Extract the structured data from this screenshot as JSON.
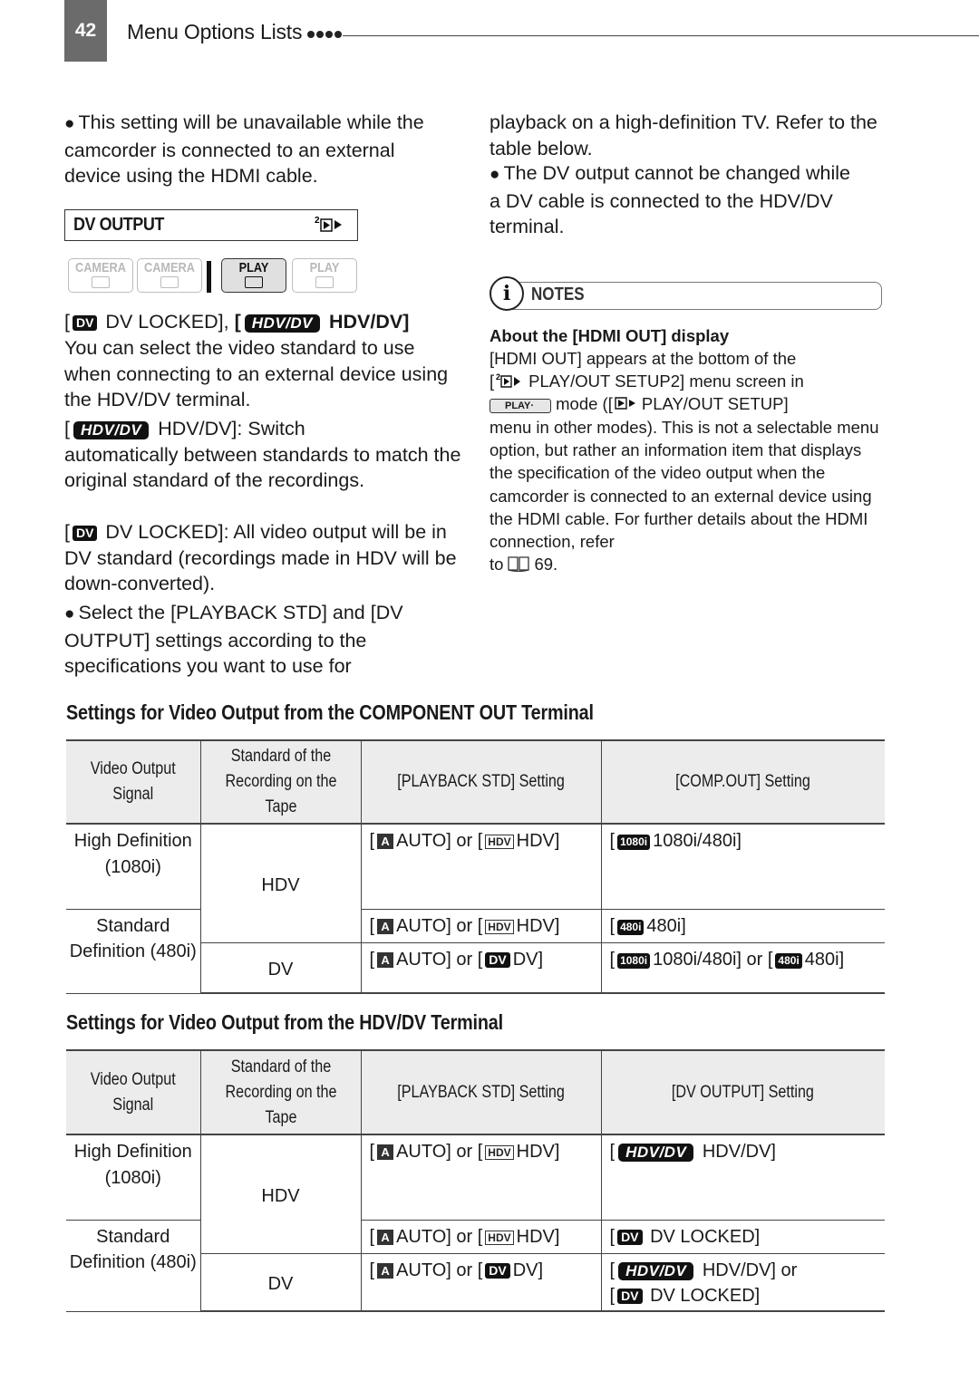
{
  "header": {
    "page_number": "42",
    "running_title": "Menu Options Lists"
  },
  "left_column": {
    "intro_bullet": "This setting will be unavailable while the camcorder is connected to an external device using the HDMI cable.",
    "menu_item": {
      "title": "DV OUTPUT",
      "menu_icon": "play-out-setup-2-icon"
    },
    "modes": [
      {
        "label": "CAMERA",
        "sub_icon": "tape-icon",
        "active": false
      },
      {
        "label": "CAMERA",
        "sub_icon": "card-icon",
        "active": false
      },
      {
        "label": "PLAY",
        "sub_icon": "tape-icon",
        "active": true
      },
      {
        "label": "PLAY",
        "sub_icon": "card-icon",
        "active": false
      }
    ],
    "options_line": {
      "opt1_icon": "DV",
      "opt1_label": "DV LOCKED],",
      "opt2_icon": "HDV/DV",
      "opt2_label": "HDV/DV]"
    },
    "description": "You can select the video standard to use when connecting to an external device using the HDV/DV terminal.",
    "hdvdv_desc": {
      "icon": "HDV/DV",
      "label": "HDV/DV]: Switch",
      "text": "automatically between standards to match the original standard of the recordings."
    },
    "dvlocked_desc": {
      "icon": "DV",
      "label": "DV LOCKED]: All video output will",
      "text": "be in DV standard (recordings made in HDV will be down-converted)."
    },
    "select_bullet": "Select the [PLAYBACK STD] and [DV OUTPUT] settings according to the specifications you want to use for"
  },
  "right_column": {
    "continuation": "playback on a high-definition TV. Refer to the table below.",
    "bullet": "The DV output cannot be changed while a DV cable is connected to the HDV/DV terminal.",
    "notes": {
      "title": "NOTES",
      "subheading": "About the [HDMI OUT] display",
      "line1": "[HDMI OUT] appears at the bottom of the",
      "line2_suffix": "PLAY/OUT SETUP2] menu screen in",
      "play_mode_icon": "PLAY·",
      "line3_mid": "mode ([",
      "line3_suffix": "PLAY/OUT SETUP]",
      "body": "menu in other modes). This is not a selectable menu option, but rather an information item that displays the specification of the video output when the camcorder is connected to an external device using the HDMI cable. For further details about the HDMI connection, refer",
      "ref_prefix": "to",
      "ref_page": "69."
    }
  },
  "tables": [
    {
      "heading": "Settings for Video Output from the COMPONENT OUT Terminal",
      "columns": [
        "Video Output Signal",
        "Standard of the Recording on the Tape",
        "[PLAYBACK STD] Setting",
        "[COMP.OUT] Setting"
      ],
      "signal_groups": [
        "High Definition (1080i)",
        "Standard Definition (480i)"
      ],
      "tape_groups": [
        "HDV",
        "DV"
      ],
      "rows": [
        {
          "playback": {
            "a": "AUTO] or [",
            "b_icon": "HDV",
            "b": "HDV]"
          },
          "setting": "[ 1080i 1080i/480i]"
        },
        {
          "playback": {
            "a": "AUTO] or [",
            "b_icon": "HDV",
            "b": "HDV]"
          },
          "setting": "[ 480i 480i]"
        },
        {
          "playback": {
            "a": "AUTO] or [",
            "b_icon": "DV",
            "b": "DV]"
          },
          "setting": "[ 1080i 1080i/480i] or [ 480i 480i]"
        }
      ],
      "setting_cells": [
        {
          "parts": [
            {
              "icon": "1080i",
              "text": "1080i/480i]"
            }
          ]
        },
        {
          "parts": [
            {
              "icon": "480i",
              "text": "480i]"
            }
          ]
        },
        {
          "parts": [
            {
              "icon": "1080i",
              "text": "1080i/480i] or ["
            },
            {
              "icon": "480i",
              "text": "480i]"
            }
          ]
        }
      ]
    },
    {
      "heading": "Settings for Video Output from the HDV/DV Terminal",
      "columns": [
        "Video Output Signal",
        "Standard of the Recording on the Tape",
        "[PLAYBACK STD] Setting",
        "[DV OUTPUT] Setting"
      ],
      "signal_groups": [
        "High Definition (1080i)",
        "Standard Definition (480i)"
      ],
      "tape_groups": [
        "HDV",
        "DV"
      ],
      "rows": [
        {
          "playback": {
            "a": "AUTO] or [",
            "b_icon": "HDV",
            "b": "HDV]"
          },
          "setting": "[ HDV/DV HDV/DV]"
        },
        {
          "playback": {
            "a": "AUTO] or [",
            "b_icon": "HDV",
            "b": "HDV]"
          },
          "setting": "[ DV DV LOCKED]"
        },
        {
          "playback": {
            "a": "AUTO] or [",
            "b_icon": "DV",
            "b": "DV]"
          },
          "setting": "[ HDV/DV HDV/DV] or [ DV DV LOCKED]"
        }
      ],
      "setting_cells": [
        {
          "icon": "HDV/DV",
          "text": "HDV/DV]"
        },
        {
          "icon": "DV",
          "text": "DV LOCKED]"
        },
        {
          "icon": "HDV/DV",
          "text": "HDV/DV] or",
          "icon2": "DV",
          "text2": "DV LOCKED]"
        }
      ]
    }
  ],
  "icon_labels": {
    "auto": "A",
    "a_label": "AUTO] or ["
  }
}
